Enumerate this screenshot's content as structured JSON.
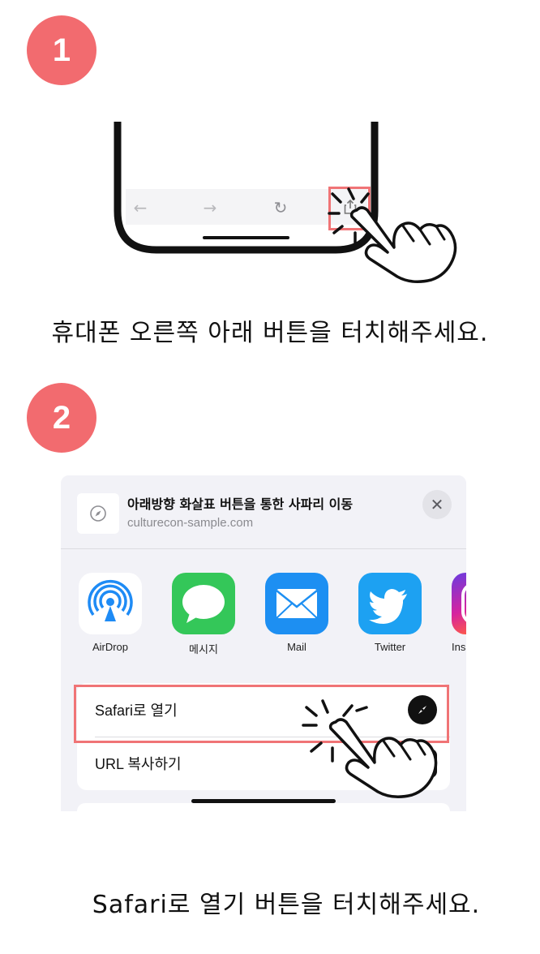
{
  "step1": {
    "badge": "1",
    "caption": "휴대폰 오른쪽 아래 버튼을 터치해주세요."
  },
  "browser_toolbar": {
    "back_icon": "←",
    "forward_icon": "→",
    "reload_icon": "↻"
  },
  "step2": {
    "badge": "2",
    "caption": "Safari로 열기 버튼을 터치해주세요."
  },
  "share_sheet": {
    "title": "아래방향 화살표 버튼을 통한 사파리 이동",
    "url": "culturecon-sample.com",
    "close_label": "✕",
    "apps": [
      {
        "label": "AirDrop",
        "icon": "airdrop-icon"
      },
      {
        "label": "메시지",
        "icon": "messages-icon"
      },
      {
        "label": "Mail",
        "icon": "mail-icon"
      },
      {
        "label": "Twitter",
        "icon": "twitter-icon"
      },
      {
        "label": "Ins",
        "icon": "instagram-icon"
      }
    ],
    "actions": [
      {
        "label": "Safari로 열기",
        "icon": "compass-icon"
      },
      {
        "label": "URL 복사하기",
        "icon": "link-icon"
      }
    ]
  },
  "colors": {
    "accent": "#f26b6f",
    "highlight": "#f07476"
  }
}
